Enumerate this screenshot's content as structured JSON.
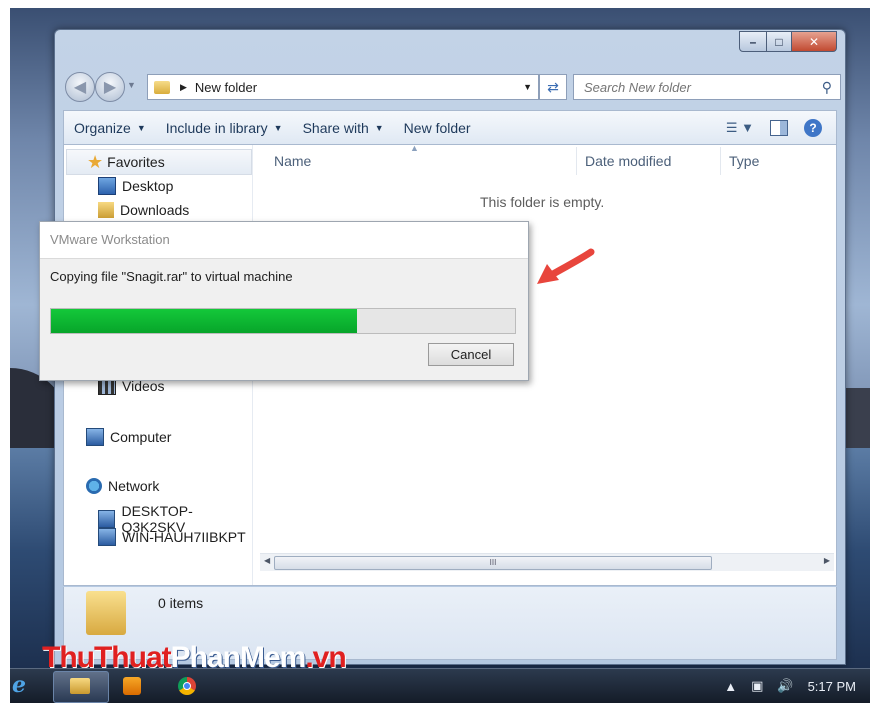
{
  "window": {
    "address_path": "New folder",
    "search_placeholder": "Search New folder",
    "toolbar": {
      "organize": "Organize",
      "include_in_library": "Include in library",
      "share_with": "Share with",
      "new_folder": "New folder"
    },
    "nav": {
      "favorites": "Favorites",
      "desktop": "Desktop",
      "downloads": "Downloads",
      "videos": "Videos",
      "computer": "Computer",
      "network": "Network",
      "network_items": [
        "DESKTOP-Q3K2SKV",
        "WIN-HAUH7IIBKPT"
      ]
    },
    "columns": {
      "name": "Name",
      "date_modified": "Date modified",
      "type": "Type"
    },
    "empty_message": "This folder is empty.",
    "details": {
      "item_count": "0 items"
    },
    "scrollbar_grip": "III"
  },
  "dialog": {
    "title": "VMware Workstation",
    "message": "Copying file \"Snagit.rar\" to virtual machine",
    "progress_percent": 66,
    "cancel_label": "Cancel"
  },
  "taskbar": {
    "time": "5:17 PM"
  },
  "watermark": {
    "part1": "ThuThuat",
    "part2": "PhanMem",
    "part3": ".vn"
  },
  "colors": {
    "progress": "#0cb532",
    "accent_arrow": "#e8453c"
  }
}
